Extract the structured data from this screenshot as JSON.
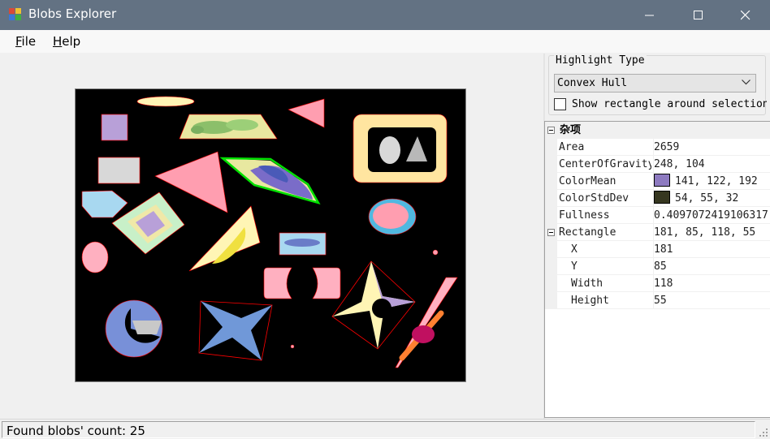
{
  "window": {
    "title": "Blobs Explorer",
    "minimize_icon": "minimize-icon",
    "maximize_icon": "maximize-icon",
    "close_icon": "close-icon"
  },
  "menu": {
    "file": {
      "accel": "F",
      "rest": "ile"
    },
    "help": {
      "accel": "H",
      "rest": "elp"
    }
  },
  "highlight": {
    "legend": "Highlight Type",
    "selected": "Convex Hull",
    "show_rect_label": "Show rectangle around selection"
  },
  "property_grid": {
    "category": "杂项",
    "rows": [
      {
        "name": "Area",
        "value": "2659"
      },
      {
        "name": "CenterOfGravity",
        "value": "248, 104"
      },
      {
        "name": "ColorMean",
        "value": "141, 122, 192",
        "swatch": "#8d7ac0"
      },
      {
        "name": "ColorStdDev",
        "value": "54, 55, 32",
        "swatch": "#363720"
      },
      {
        "name": "Fullness",
        "value": "0.4097072419106317"
      },
      {
        "name": "Rectangle",
        "value": "181, 85, 118, 55"
      },
      {
        "name": "X",
        "value": "181"
      },
      {
        "name": "Y",
        "value": "85"
      },
      {
        "name": "Width",
        "value": "118"
      },
      {
        "name": "Height",
        "value": "55"
      }
    ]
  },
  "status": {
    "text": "Found blobs' count: 25"
  },
  "colors": {
    "titlebar": "#637283",
    "highlight_hull": "#00e000",
    "blob_outline": "#ff0000"
  }
}
